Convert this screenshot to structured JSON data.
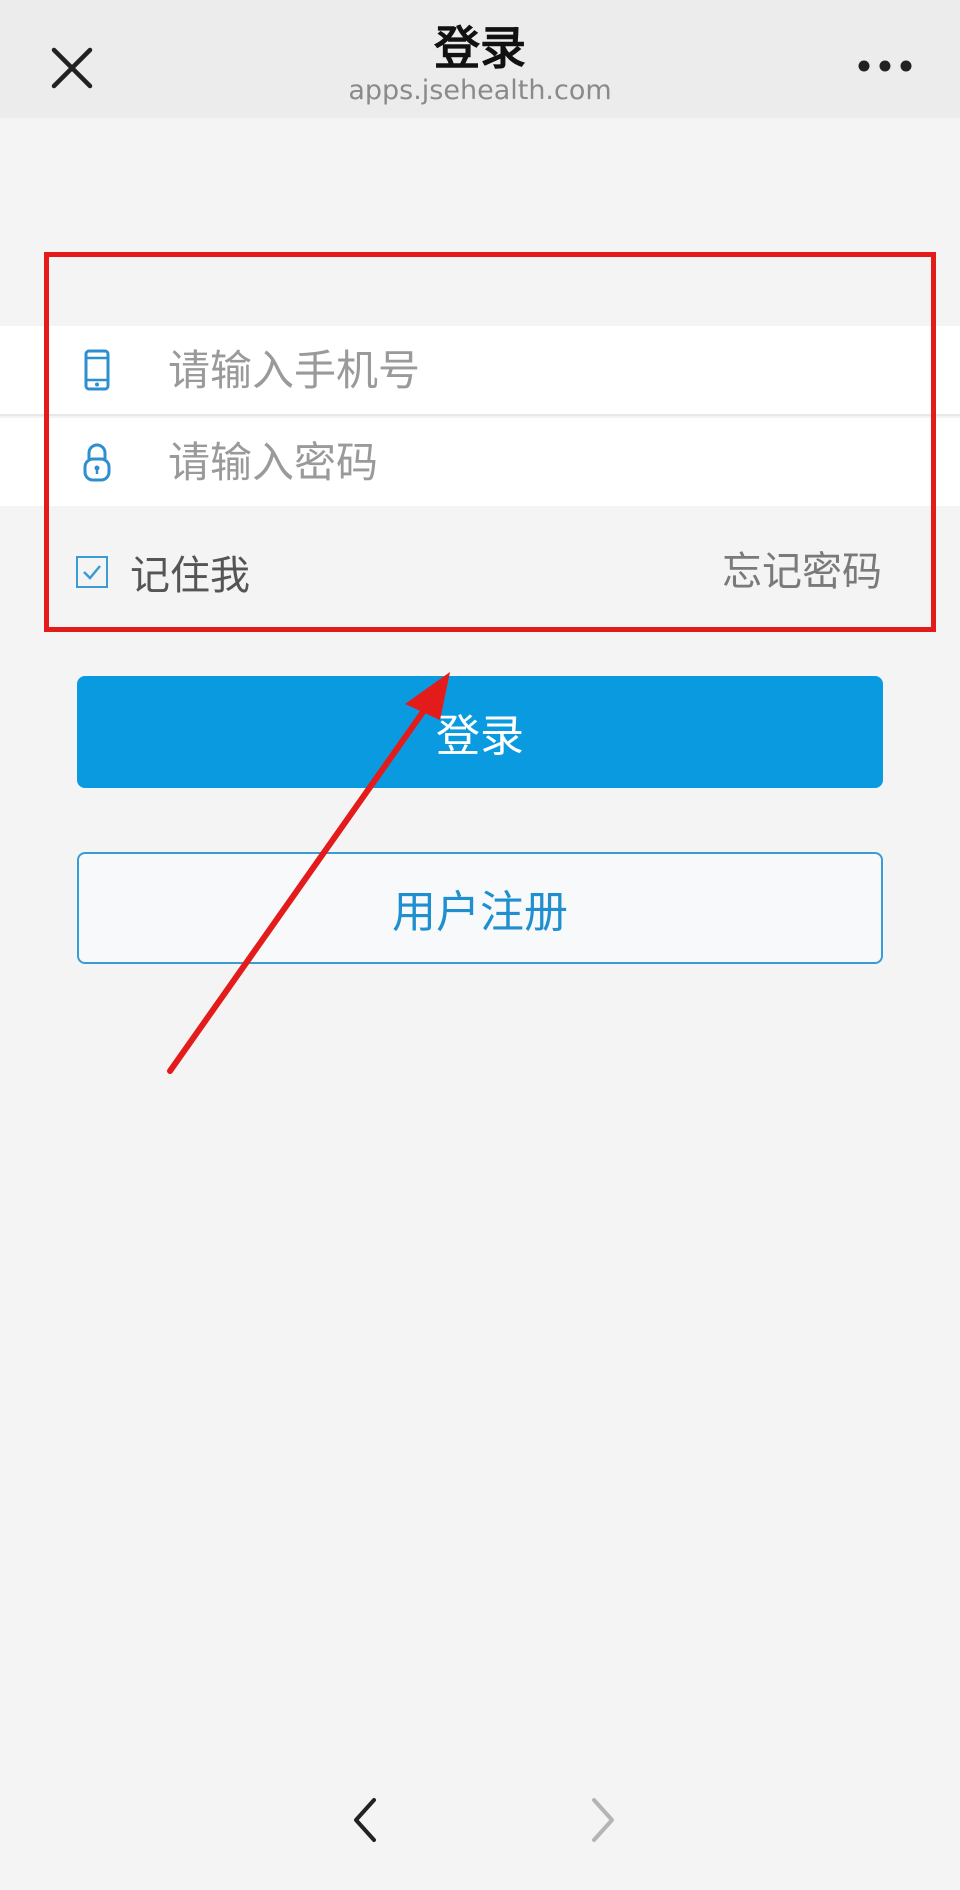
{
  "header": {
    "title": "登录",
    "url": "apps.jsehealth.com",
    "close_icon": "close-icon",
    "more_icon": "more-dots-icon"
  },
  "form": {
    "phone": {
      "placeholder": "请输入手机号",
      "value": "",
      "icon": "mobile-phone-icon"
    },
    "password": {
      "placeholder": "请输入密码",
      "value": "",
      "icon": "lock-icon"
    },
    "remember": {
      "label": "记住我",
      "checked": true
    },
    "forgot_label": "忘记密码"
  },
  "buttons": {
    "login_label": "登录",
    "register_label": "用户注册"
  },
  "bottom_nav": {
    "back_icon": "chevron-left-icon",
    "forward_icon": "chevron-right-icon",
    "forward_enabled": false
  },
  "colors": {
    "accent": "#0a9ae0",
    "annotation": "#e31b1b",
    "background": "#f4f4f4"
  }
}
